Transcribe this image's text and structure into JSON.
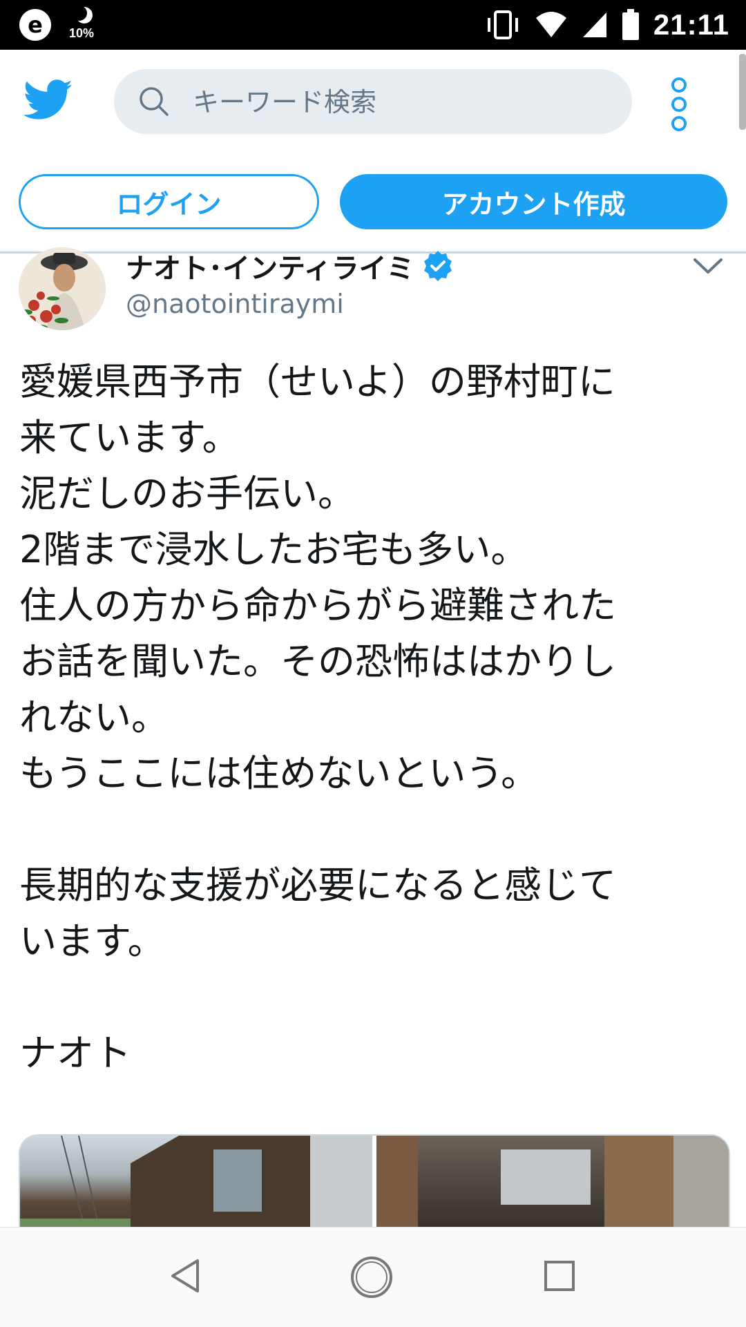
{
  "status_bar": {
    "app_badge": "e",
    "battery_saver_percent": "10%",
    "time": "21:11",
    "icons": [
      "vibrate-icon",
      "wifi-icon",
      "signal-icon",
      "battery-icon"
    ]
  },
  "header": {
    "search_placeholder": "キーワード検索",
    "logo": "twitter-bird-icon",
    "menu": "more-vertical-icon"
  },
  "auth": {
    "login_label": "ログイン",
    "signup_label": "アカウント作成"
  },
  "tweet": {
    "display_name": "ナオト･インティライミ",
    "handle": "@naotointiraymi",
    "verified": true,
    "lines": [
      "愛媛県西予市（せいよ）の野村町に",
      "来ています。",
      "泥だしのお手伝い。",
      "2階まで浸水したお宅も多い。",
      "住人の方から命からがら避難された",
      "お話を聞いた。その恐怖ははかりし",
      "れない。",
      "もうここには住めないという。",
      "",
      "長期的な支援が必要になると感じて",
      "います。",
      "",
      "ナオト"
    ]
  },
  "colors": {
    "accent": "#1da1f2",
    "search_bg": "#e6ecf0",
    "secondary_text": "#657786",
    "text": "#14171a"
  }
}
